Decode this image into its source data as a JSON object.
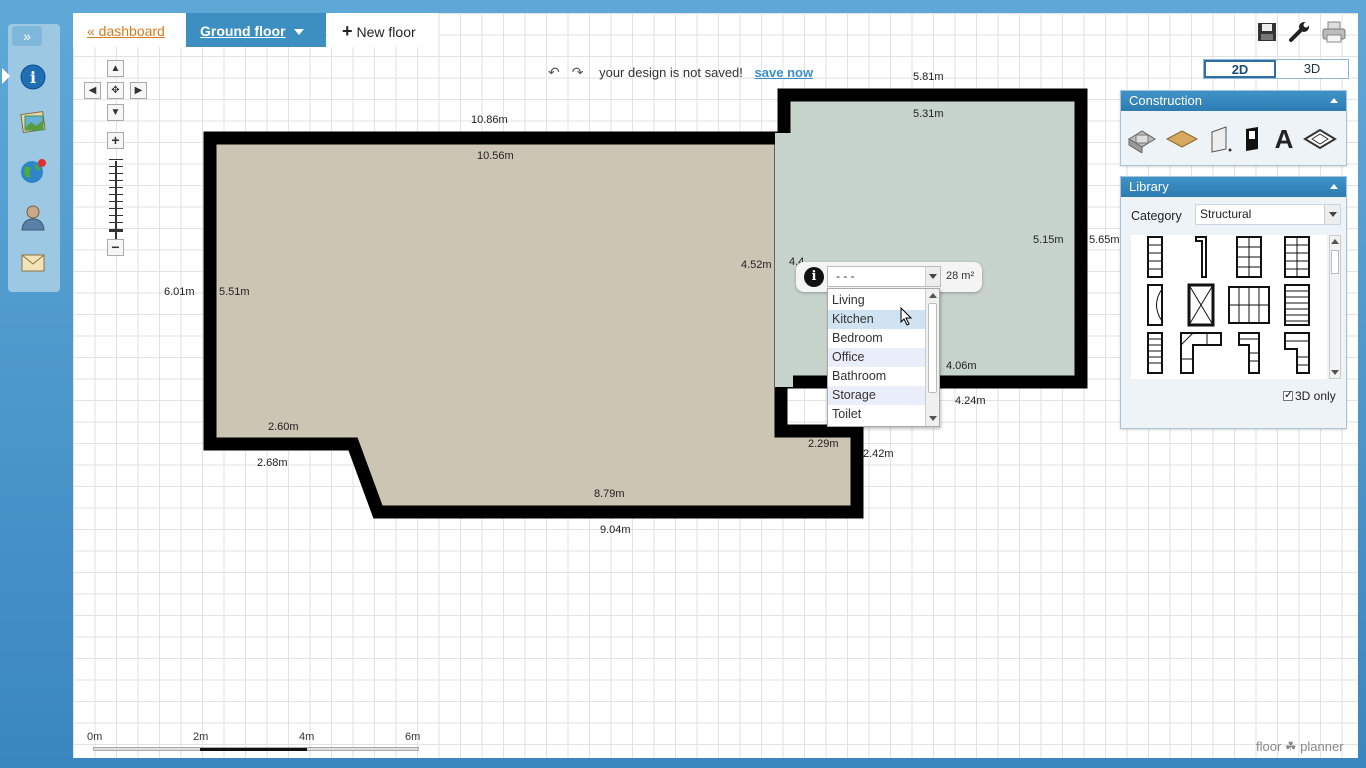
{
  "left_rail": {
    "toggle": "»",
    "items": [
      "info-icon",
      "photos-icon",
      "globe-icon",
      "user-icon",
      "mail-icon"
    ]
  },
  "tabs": {
    "dashboard": "« dashboard",
    "ground_floor": "Ground floor",
    "new_floor": "New floor"
  },
  "toolbar": {
    "icons": [
      "save-icon",
      "wrench-icon",
      "print-icon"
    ]
  },
  "notice": {
    "undo": "↶",
    "redo": "↷",
    "message": "your design is not saved!",
    "save_link": "save now"
  },
  "view_toggle": {
    "two_d": "2D",
    "three_d": "3D",
    "active": "2D"
  },
  "navigation": {
    "up": "▲",
    "down": "▼",
    "left": "◀",
    "right": "▶",
    "center": "✥",
    "zoom_in": "+",
    "zoom_out": "−"
  },
  "dimensions": {
    "top_outer": "10.86m",
    "top_inner": "10.56m",
    "left_outer": "6.01m",
    "left_inner": "5.51m",
    "bottom_left_inner": "2.60m",
    "bottom_left_outer": "2.68m",
    "bottom_inner": "8.79m",
    "bottom_outer": "9.04m",
    "mid_left": "4.52m",
    "mid_right": "4.4",
    "step_inner": "2.29m",
    "step_outer": "2.42m",
    "room2_top_outer": "5.81m",
    "room2_top_inner": "5.31m",
    "room2_right_inner": "5.15m",
    "room2_right_outer": "5.65m",
    "room2_bottom_inner": "4.06m",
    "room2_bottom_outer": "4.24m"
  },
  "room_popup": {
    "select_value": "- - -",
    "area": "28 m²",
    "options": [
      "Living",
      "Kitchen",
      "Bedroom",
      "Office",
      "Bathroom",
      "Storage",
      "Toilet"
    ]
  },
  "construction": {
    "title": "Construction",
    "tools": [
      "wall-icon",
      "floor-icon",
      "door-icon",
      "window-icon",
      "text-icon",
      "surface-icon"
    ],
    "text_tool_label": "A"
  },
  "library": {
    "title": "Library",
    "category_label": "Category",
    "category_value": "Structural",
    "items": [
      "stair-straight",
      "stair-narrow",
      "stair-l",
      "stair-spiral-square",
      "stair-winder",
      "stair-square-spiral",
      "stair-double",
      "stair-wide",
      "stair-long",
      "stair-corner",
      "stair-small",
      "stair-turn"
    ],
    "three_d_only": "3D only"
  },
  "scale": {
    "labels": [
      "0m",
      "2m",
      "4m",
      "6m"
    ]
  },
  "brand": "floor ☘ planner",
  "colors": {
    "room_main": "#cdc5b4",
    "room_second": "#c7d4cc",
    "wall": "#000000",
    "accent": "#3d8fc2",
    "link": "#d87a1e"
  }
}
